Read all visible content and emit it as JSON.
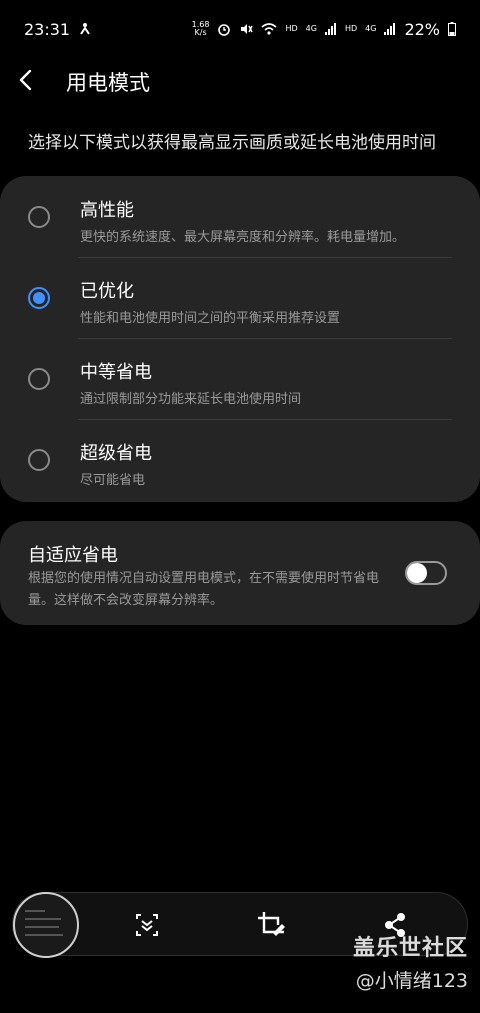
{
  "status": {
    "time": "23:31",
    "speed_value": "1.68",
    "speed_unit": "K/s",
    "hd1": "HD",
    "net1": "4G",
    "hd2": "HD",
    "net2": "4G",
    "battery": "22%"
  },
  "header": {
    "title": "用电模式"
  },
  "intro": "选择以下模式以获得最高显示画质或延长电池使用时间",
  "modes": [
    {
      "title": "高性能",
      "desc": "更快的系统速度、最大屏幕亮度和分辨率。耗电量增加。",
      "selected": false
    },
    {
      "title": "已优化",
      "desc": "性能和电池使用时间之间的平衡采用推荐设置",
      "selected": true
    },
    {
      "title": "中等省电",
      "desc": "通过限制部分功能来延长电池使用时间",
      "selected": false
    },
    {
      "title": "超级省电",
      "desc": "尽可能省电",
      "selected": false
    }
  ],
  "adaptive": {
    "title": "自适应省电",
    "desc": "根据您的使用情况自动设置用电模式，在不需要使用时节省电量。这样做不会改变屏幕分辨率。",
    "enabled": false
  },
  "watermark": {
    "site": "盖乐世社区",
    "user": "@小情绪123"
  },
  "colors": {
    "accent": "#3e91ff",
    "card": "#252525",
    "background": "#000000"
  }
}
